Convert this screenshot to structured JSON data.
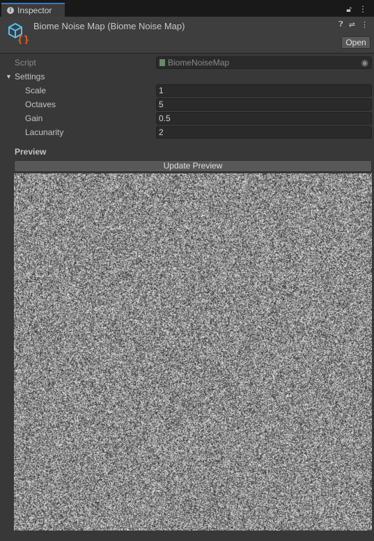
{
  "tab": {
    "label": "Inspector"
  },
  "header": {
    "title": "Biome Noise Map (Biome Noise Map)",
    "open_label": "Open"
  },
  "script": {
    "label": "Script",
    "value": "BiomeNoiseMap"
  },
  "settings": {
    "label": "Settings",
    "fields": [
      {
        "label": "Scale",
        "value": "1"
      },
      {
        "label": "Octaves",
        "value": "5"
      },
      {
        "label": "Gain",
        "value": "0.5"
      },
      {
        "label": "Lacunarity",
        "value": "2"
      }
    ]
  },
  "preview": {
    "label": "Preview",
    "button_label": "Update Preview"
  },
  "colors": {
    "accent": "#3a79bb",
    "icon_cube": "#4fc3f7",
    "icon_braces": "#f05a28"
  }
}
